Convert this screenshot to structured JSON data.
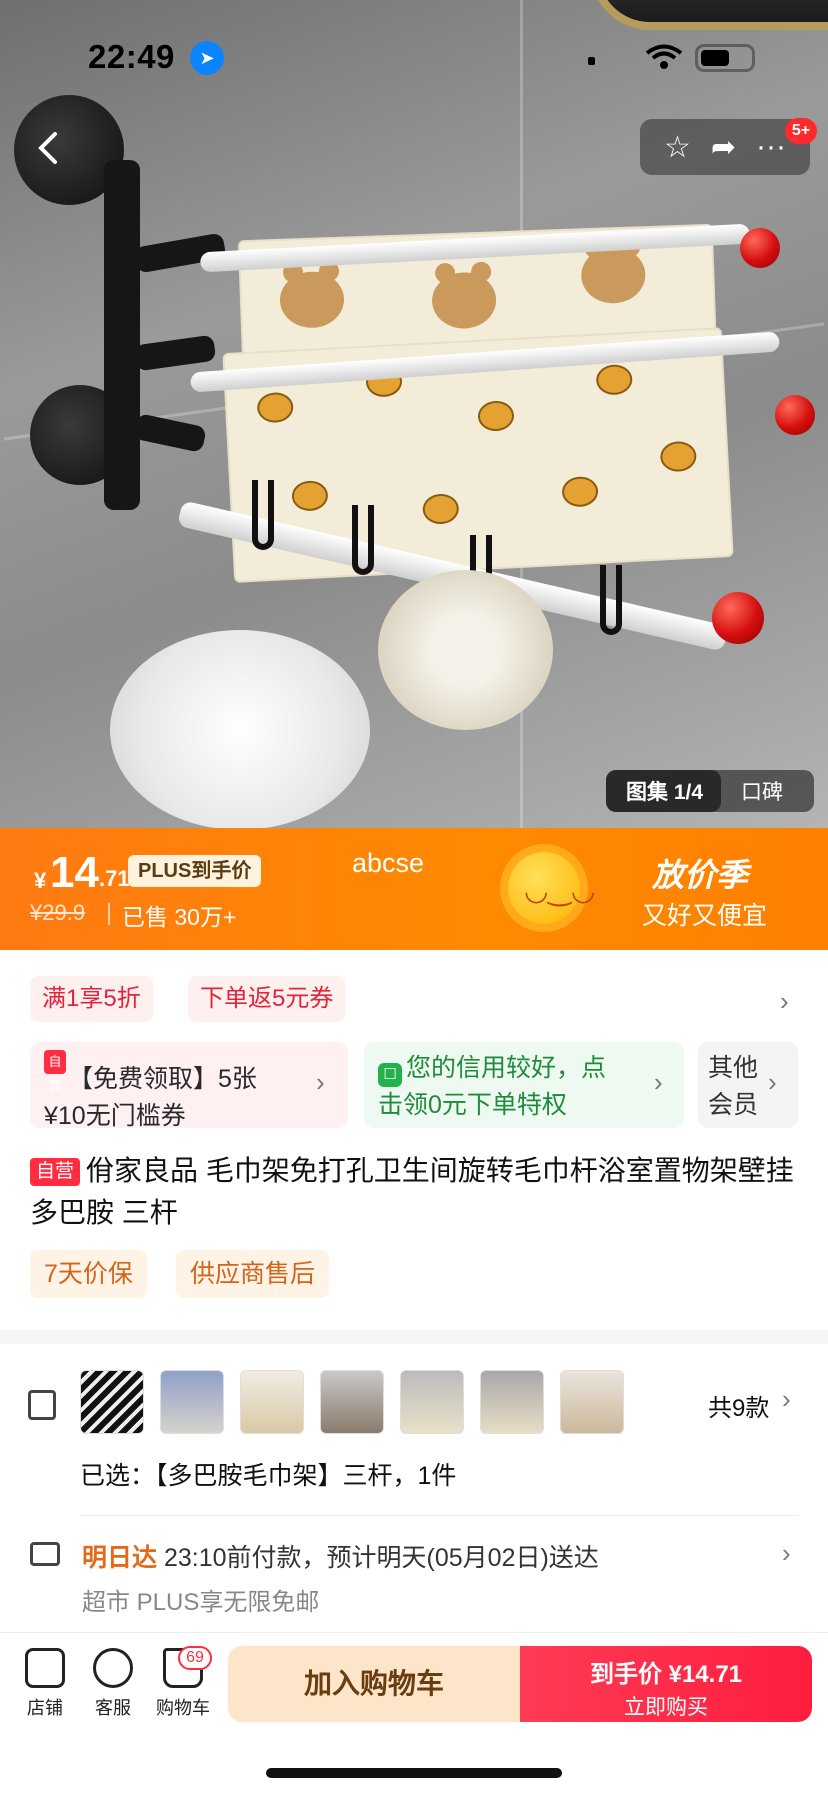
{
  "status_bar": {
    "time": "22:49"
  },
  "nav": {
    "notification_badge": "5+"
  },
  "gallery": {
    "label": "图集 1/4",
    "reviews": "口碑"
  },
  "promo": {
    "currency": "¥",
    "price_int": "14",
    "price_dec": ".71",
    "plus_tag": "PLUS到手价",
    "old_price": "¥29.9",
    "sold": "已售 30万+",
    "banner_text": "abcse",
    "season_title": "放价季",
    "season_sub": "又好又便宜"
  },
  "coupons": {
    "chip1": "满1享5折",
    "chip2": "下单返5元券",
    "card1_icon": "自营",
    "card1_line1": "【免费领取】5张",
    "card1_line2": "¥10无门槛券",
    "card2_line1": "您的信用较好，点",
    "card2_line2": "击领0元下单特权",
    "card3_line1": "其他",
    "card3_line2": "会员"
  },
  "product": {
    "self_tag": "自营",
    "title": "佾家良品 毛巾架免打孔卫生间旋转毛巾杆浴室置物架壁挂多巴胺 三杆",
    "service1": "7天价保",
    "service2": "供应商售后"
  },
  "variants": {
    "count": "共9款",
    "selected": "已选：【多巴胺毛巾架】三杆，1件"
  },
  "delivery": {
    "highlight": "明日达",
    "text": "23:10前付款，预计明天(05月02日)送达",
    "free_ship": "超市  PLUS享无限免邮"
  },
  "bottom": {
    "shop": "店铺",
    "service": "客服",
    "cart": "购物车",
    "cart_count": "69",
    "add_cart": "加入购物车",
    "buy_line1_label": "到手价",
    "buy_price": "¥14.71",
    "buy_line2": "立即购买"
  },
  "colors": {
    "accent_orange": "#ff8a00",
    "buy_red": "#ff1d3d",
    "coupon_red": "#e0243b"
  }
}
